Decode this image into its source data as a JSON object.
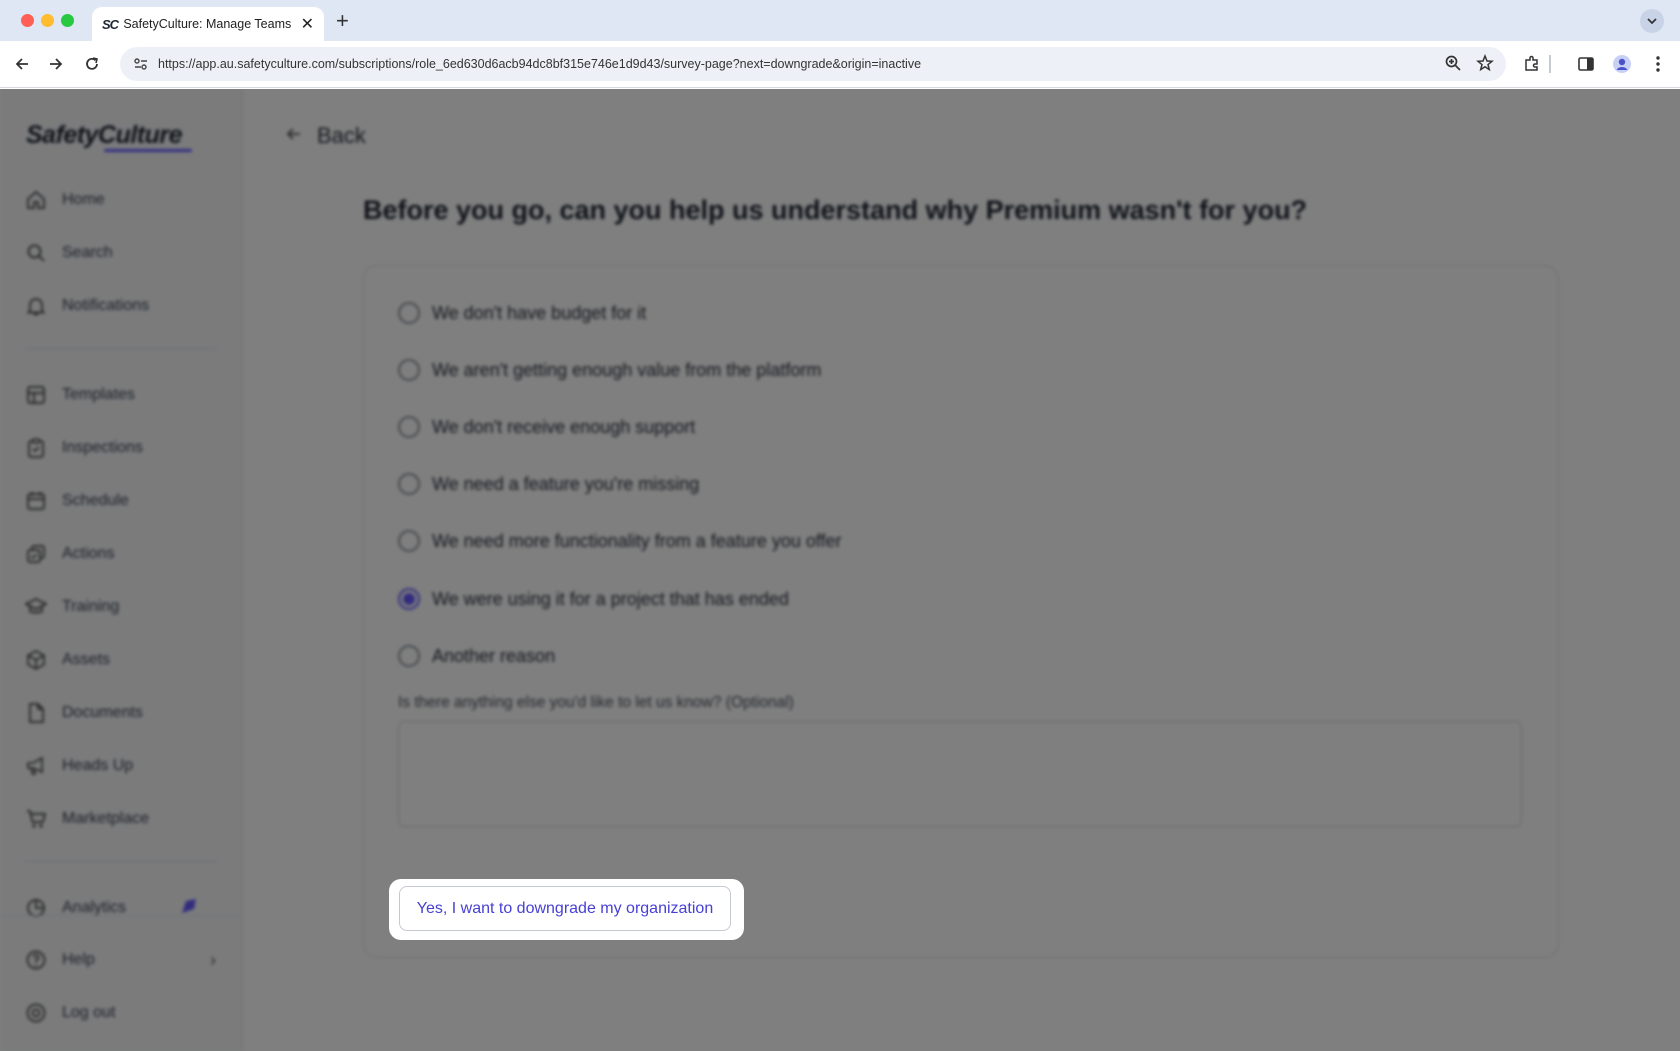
{
  "browser": {
    "tab_title": "SafetyCulture: Manage Teams and...",
    "tab_favicon": "SC",
    "url": "https://app.au.safetyculture.com/subscriptions/role_6ed630d6acb94dc8bf315e746e1d9d43/survey-page?next=downgrade&origin=inactive"
  },
  "sidebar": {
    "logo": "SafetyCulture",
    "items": [
      {
        "label": "Home",
        "icon": "home-icon"
      },
      {
        "label": "Search",
        "icon": "search-icon"
      },
      {
        "label": "Notifications",
        "icon": "bell-icon"
      },
      {
        "label": "Templates",
        "icon": "templates-icon"
      },
      {
        "label": "Inspections",
        "icon": "clipboard-icon"
      },
      {
        "label": "Schedule",
        "icon": "calendar-icon"
      },
      {
        "label": "Actions",
        "icon": "actions-icon"
      },
      {
        "label": "Training",
        "icon": "graduation-cap-icon"
      },
      {
        "label": "Assets",
        "icon": "cube-icon"
      },
      {
        "label": "Documents",
        "icon": "document-icon"
      },
      {
        "label": "Heads Up",
        "icon": "megaphone-icon"
      },
      {
        "label": "Marketplace",
        "icon": "cart-icon"
      },
      {
        "label": "Analytics",
        "icon": "chart-icon"
      },
      {
        "label": "Help",
        "icon": "help-icon"
      },
      {
        "label": "Log out",
        "icon": "logout-icon"
      }
    ]
  },
  "main": {
    "back_label": "Back",
    "heading": "Before you go, can you help us understand why Premium wasn't for you?",
    "options": [
      {
        "label": "We don't have budget for it",
        "selected": false
      },
      {
        "label": "We aren't getting enough value from the platform",
        "selected": false
      },
      {
        "label": "We don't receive enough support",
        "selected": false
      },
      {
        "label": "We need a feature you're missing",
        "selected": false
      },
      {
        "label": "We need more functionality from a feature you offer",
        "selected": false
      },
      {
        "label": "We were using it for a project that has ended",
        "selected": true
      },
      {
        "label": "Another reason",
        "selected": false
      }
    ],
    "textarea_label": "Is there anything else you'd like to let us know? (Optional)",
    "textarea_value": "",
    "cta_label": "Yes, I want to downgrade my organization"
  },
  "colors": {
    "accent": "#6559ff",
    "cta_text": "#4740d4",
    "overlay": "rgba(0,0,0,0.5)"
  }
}
